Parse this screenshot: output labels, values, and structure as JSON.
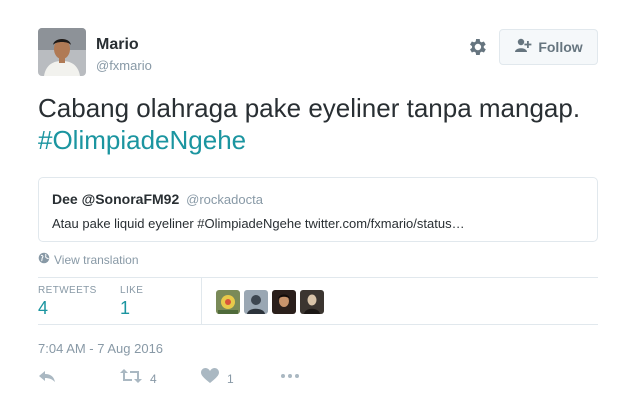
{
  "author": {
    "name": "Mario",
    "handle": "@fxmario"
  },
  "follow": {
    "label": "Follow"
  },
  "tweet": {
    "text_line1": "Cabang olahraga pake eyeliner tanpa mangap.",
    "hashtag": "#OlimpiadeNgehe"
  },
  "quote": {
    "name": "Dee @SonoraFM92",
    "handle": "@rockadocta",
    "text": "Atau pake liquid eyeliner #OlimpiadeNgehe twitter.com/fxmario/status…"
  },
  "translation": {
    "label": "View translation"
  },
  "stats": {
    "retweets_label": "RETWEETS",
    "retweets": "4",
    "likes_label": "LIKE",
    "likes": "1"
  },
  "timestamp": "7:04 AM - 7 Aug 2016",
  "actions": {
    "retweet_count": "4",
    "like_count": "1"
  },
  "icons": [
    "gear-icon",
    "follow-user-icon",
    "globe-icon",
    "reply-icon",
    "retweet-icon",
    "heart-icon",
    "more-icon"
  ],
  "colors": {
    "accent": "#1b95a0",
    "text": "#292f33",
    "muted": "#8899a6",
    "border": "#e1e8ed"
  }
}
